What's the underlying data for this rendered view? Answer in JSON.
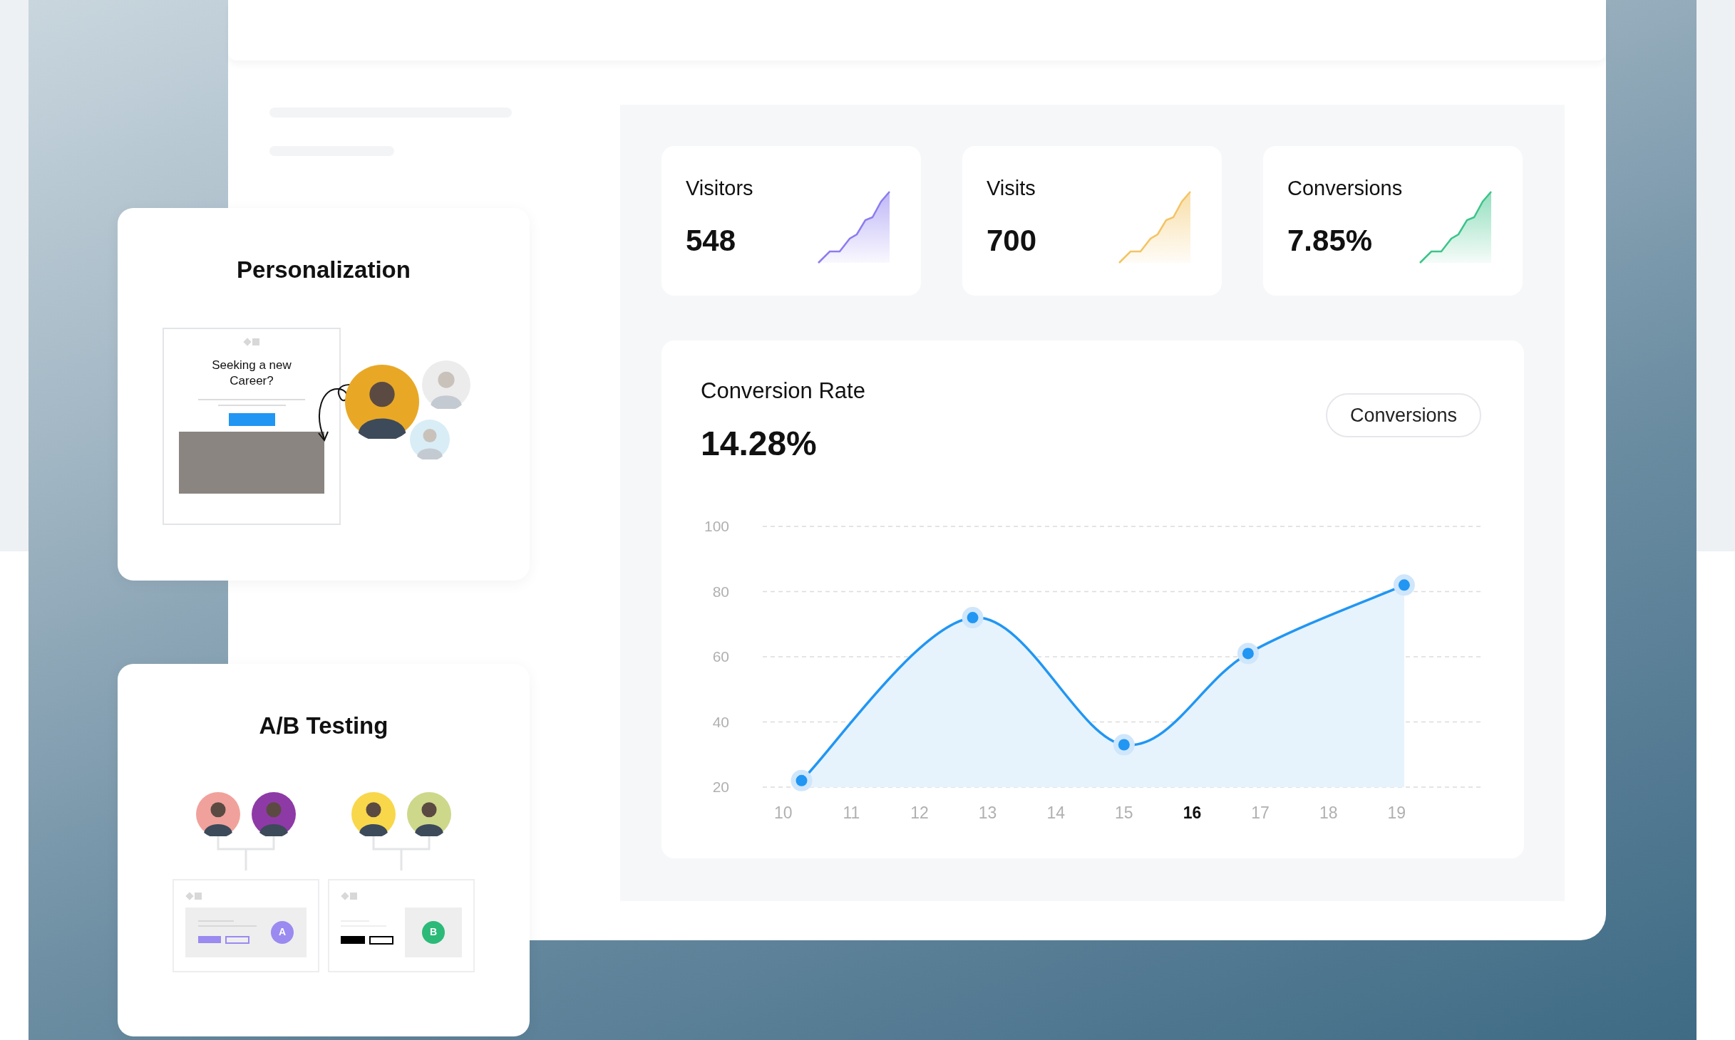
{
  "metrics": [
    {
      "label": "Visitors",
      "value": "548",
      "color": "#8b7cf0"
    },
    {
      "label": "Visits",
      "value": "700",
      "color": "#f3c463"
    },
    {
      "label": "Conversions",
      "value": "7.85%",
      "color": "#3cc48a"
    }
  ],
  "conversion_rate": {
    "title": "Conversion Rate",
    "value": "14.28%",
    "button": "Conversions",
    "chart_data": {
      "type": "area",
      "x": [
        10.27,
        12.78,
        15.0,
        16.82,
        19.11
      ],
      "values": [
        22,
        72,
        33,
        61,
        82
      ],
      "xlim": [
        9.7,
        20.23
      ],
      "ylim": [
        20,
        100
      ],
      "yticks": [
        20,
        40,
        60,
        80,
        100
      ],
      "xticks": [
        10,
        11,
        12,
        13,
        14,
        15,
        16,
        17,
        18,
        19
      ],
      "grid": true
    },
    "x_axis_labels": [
      {
        "label": "10",
        "selected": false
      },
      {
        "label": "11",
        "selected": false
      },
      {
        "label": "12",
        "selected": false
      },
      {
        "label": "13",
        "selected": false
      },
      {
        "label": "14",
        "selected": false
      },
      {
        "label": "15",
        "selected": false
      },
      {
        "label": "16",
        "selected": true
      },
      {
        "label": "17",
        "selected": false
      },
      {
        "label": "18",
        "selected": false
      },
      {
        "label": "19",
        "selected": false
      }
    ]
  },
  "personalization": {
    "title": "Personalization",
    "ad": {
      "headline": "Seeking a new Career?"
    },
    "avatars": [
      {
        "color": "#e8a826"
      },
      {
        "color": "#ececec"
      },
      {
        "color": "#d9edf6"
      }
    ]
  },
  "ab_testing": {
    "title": "A/B Testing",
    "groups": [
      {
        "avatars": [
          {
            "color": "#f1a19b"
          },
          {
            "color": "#8e3aa6"
          }
        ],
        "variant": {
          "kind": "banner",
          "badge": "A",
          "color": "#9b8af0"
        }
      },
      {
        "avatars": [
          {
            "color": "#f8d74a"
          },
          {
            "color": "#cdd88a"
          }
        ],
        "variant": {
          "kind": "split",
          "badge": "B",
          "color": "#2cba78"
        }
      }
    ]
  }
}
